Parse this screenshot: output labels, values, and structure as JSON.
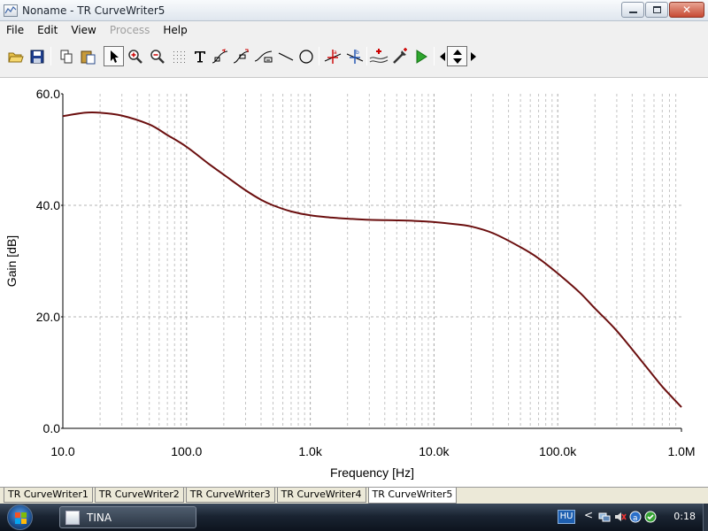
{
  "window": {
    "title": "Noname - TR CurveWriter5"
  },
  "menu": {
    "items": [
      {
        "label": "File",
        "disabled": false
      },
      {
        "label": "Edit",
        "disabled": false
      },
      {
        "label": "View",
        "disabled": false
      },
      {
        "label": "Process",
        "disabled": true
      },
      {
        "label": "Help",
        "disabled": false
      }
    ]
  },
  "toolbar": {
    "buttons": [
      "open-icon",
      "save-icon",
      "copy-icon",
      "paste-icon",
      "select-arrow-icon",
      "zoom-in-icon",
      "zoom-out-icon",
      "grid-icon",
      "text-icon",
      "curve-label-icon",
      "curve-label-alt-icon",
      "curve-fit-icon",
      "line-icon",
      "ellipse-icon",
      "cursor-a-icon",
      "cursor-b-icon",
      "add-curve-icon",
      "pick-color-icon",
      "run-icon",
      "nav-left-icon",
      "nav-updown-icon",
      "nav-right-icon"
    ]
  },
  "chart_data": {
    "type": "line",
    "xlabel": "Frequency [Hz]",
    "ylabel": "Gain [dB]",
    "xscale": "log",
    "xlim": [
      10,
      1000000
    ],
    "ylim": [
      0,
      60
    ],
    "x_tick_labels": [
      "10.0",
      "100.0",
      "1.0k",
      "10.0k",
      "100.0k",
      "1.0M"
    ],
    "y_tick_labels": [
      "0.0",
      "20.0",
      "40.0",
      "60.0"
    ],
    "y_ticks": [
      0,
      20,
      40,
      60
    ],
    "grid": true,
    "line_color": "#6b0f0f",
    "series": [
      {
        "x": [
          10,
          15,
          20,
          30,
          50,
          70,
          100,
          150,
          200,
          300,
          400,
          500,
          700,
          1000,
          1500,
          2000,
          3000,
          5000,
          7000,
          10000,
          15000,
          20000,
          30000,
          50000,
          70000,
          100000,
          150000,
          200000,
          300000,
          500000,
          700000,
          1000000
        ],
        "y": [
          56.0,
          56.6,
          56.6,
          56.1,
          54.5,
          52.6,
          50.5,
          47.5,
          45.5,
          42.7,
          41.0,
          40.0,
          38.9,
          38.2,
          37.8,
          37.6,
          37.4,
          37.3,
          37.2,
          37.0,
          36.6,
          36.2,
          35.0,
          32.5,
          30.5,
          27.8,
          24.4,
          21.5,
          17.5,
          11.5,
          7.5,
          3.8
        ]
      }
    ]
  },
  "tabs": {
    "items": [
      {
        "label": "TR CurveWriter1",
        "active": false
      },
      {
        "label": "TR CurveWriter2",
        "active": false
      },
      {
        "label": "TR CurveWriter3",
        "active": false
      },
      {
        "label": "TR CurveWriter4",
        "active": false
      },
      {
        "label": "TR CurveWriter5",
        "active": true
      }
    ]
  },
  "taskbar": {
    "app_label": "TINA",
    "language": "HU",
    "clock": "0:18"
  }
}
